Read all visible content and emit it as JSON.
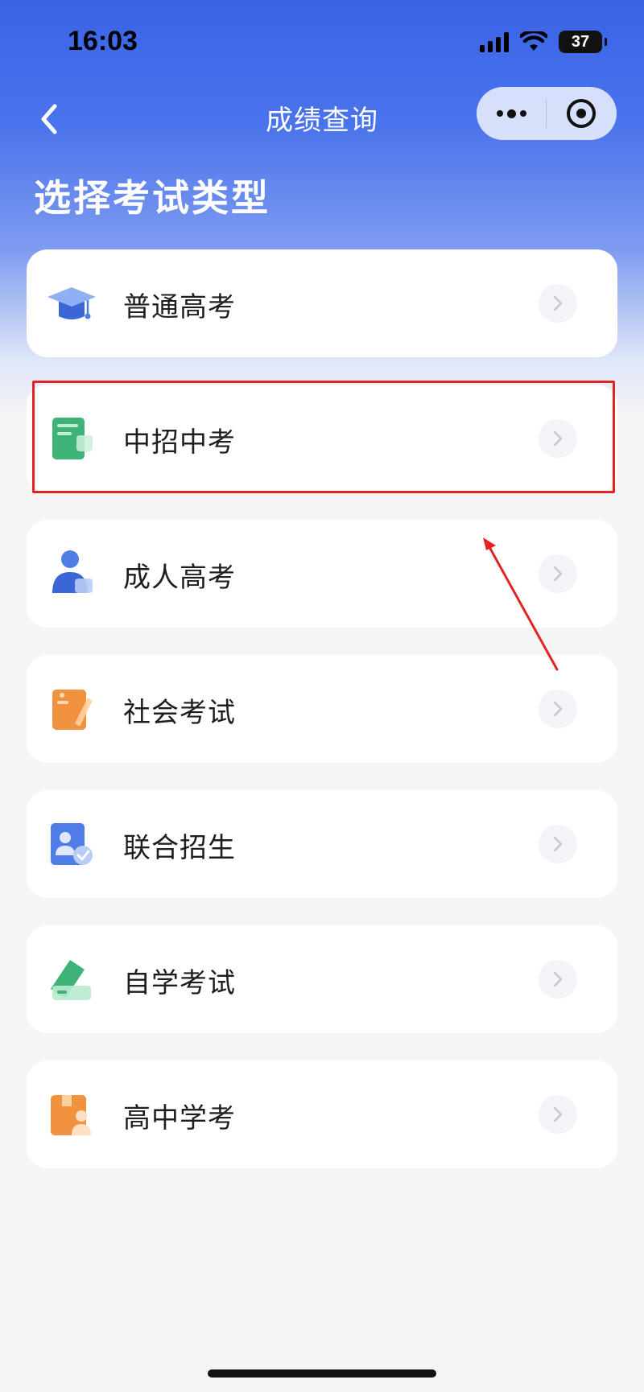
{
  "status_bar": {
    "time": "16:03",
    "battery": "37"
  },
  "nav": {
    "title": "成绩查询"
  },
  "page": {
    "title": "选择考试类型"
  },
  "exam_types": [
    {
      "label": "普通高考",
      "icon": "graduation-cap-icon"
    },
    {
      "label": "中招中考",
      "icon": "green-book-icon"
    },
    {
      "label": "成人高考",
      "icon": "adult-person-icon"
    },
    {
      "label": "社会考试",
      "icon": "orange-pen-document-icon"
    },
    {
      "label": "联合招生",
      "icon": "user-card-check-icon"
    },
    {
      "label": "自学考试",
      "icon": "green-ticket-icon"
    },
    {
      "label": "高中学考",
      "icon": "orange-box-person-icon"
    }
  ],
  "colors": {
    "header_blue": "#3a63e6",
    "annotation_red": "#e32222",
    "icon_blue": "#4f7de8",
    "icon_green": "#3db377",
    "icon_orange": "#f0923e"
  }
}
